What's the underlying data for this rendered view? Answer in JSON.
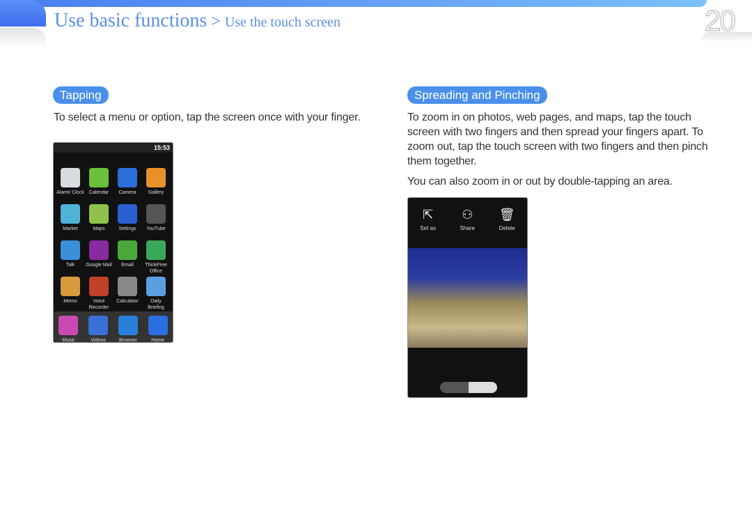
{
  "header": {
    "section": "Use basic functions",
    "separator": ">",
    "subsection": "Use the touch screen",
    "page_number": "20"
  },
  "tapping": {
    "label": "Tapping",
    "text": "To select a menu or option, tap the screen once with your finger.",
    "phone": {
      "time": "15:53",
      "apps": [
        {
          "label": "Alarm/ Clock",
          "color": "#d9dde2"
        },
        {
          "label": "Calendar",
          "color": "#6bbf3a"
        },
        {
          "label": "Camera",
          "color": "#2a6fd8"
        },
        {
          "label": "Gallery",
          "color": "#e8902a"
        },
        {
          "label": "Market",
          "color": "#4fb3d8"
        },
        {
          "label": "Maps",
          "color": "#8fc24a"
        },
        {
          "label": "Settings",
          "color": "#2a5fd0"
        },
        {
          "label": "YouTube",
          "color": "#555"
        },
        {
          "label": "Talk",
          "color": "#3a8fd8"
        },
        {
          "label": "Google Mail",
          "color": "#8a2aa0"
        },
        {
          "label": "Email",
          "color": "#4aa83a"
        },
        {
          "label": "ThinkFree Office",
          "color": "#3aa85a"
        },
        {
          "label": "Memo",
          "color": "#d89a3a"
        },
        {
          "label": "Voice Recorder",
          "color": "#c0402a"
        },
        {
          "label": "Calculator",
          "color": "#888"
        },
        {
          "label": "Daily Briefing",
          "color": "#5aa0e0"
        }
      ],
      "dock": [
        {
          "label": "Music",
          "color": "#c84ab0"
        },
        {
          "label": "Videos",
          "color": "#3a6fd8"
        },
        {
          "label": "Browser",
          "color": "#2a7fd8"
        },
        {
          "label": "Home",
          "color": "#2a6fe0"
        }
      ]
    }
  },
  "spreading": {
    "label": "Spreading and Pinching",
    "text": "To zoom in on photos, web pages, and maps, tap the touch screen with two fingers and then spread your fingers apart. To zoom out, tap the touch screen with two fingers and then pinch them together.",
    "text2": "You can also zoom in or out by double-tapping an area.",
    "phone": {
      "actions": [
        {
          "label": "Set as",
          "icon": "set-as-icon",
          "glyph": "⇱"
        },
        {
          "label": "Share",
          "icon": "share-icon",
          "glyph": "⚇"
        },
        {
          "label": "Delete",
          "icon": "trash-icon",
          "glyph": "🗑"
        }
      ]
    }
  },
  "colors": {
    "accent": "#4a90ea",
    "title": "#5a8fe8"
  }
}
